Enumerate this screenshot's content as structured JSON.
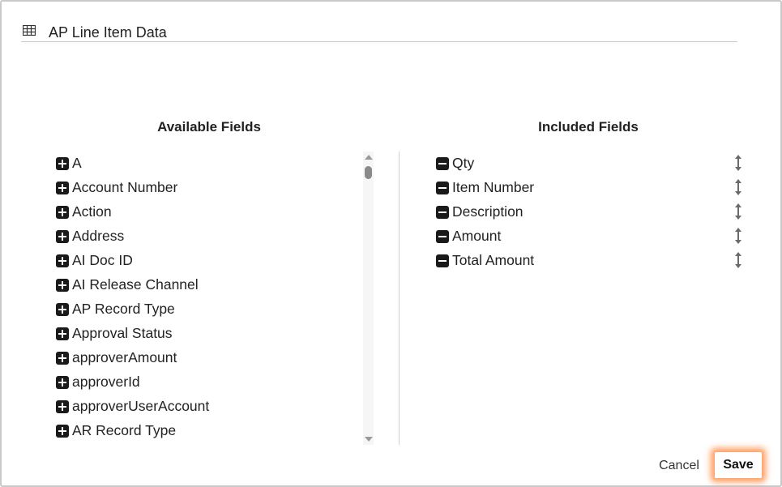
{
  "header": {
    "title": "AP Line Item Data",
    "icon": "table-grid-icon"
  },
  "available": {
    "title": "Available Fields",
    "items": [
      {
        "label": "A"
      },
      {
        "label": "Account Number"
      },
      {
        "label": "Action"
      },
      {
        "label": "Address"
      },
      {
        "label": "AI Doc ID"
      },
      {
        "label": "AI Release Channel"
      },
      {
        "label": "AP Record Type"
      },
      {
        "label": "Approval Status"
      },
      {
        "label": "approverAmount"
      },
      {
        "label": "approverId"
      },
      {
        "label": "approverUserAccount"
      },
      {
        "label": "AR Record Type"
      }
    ]
  },
  "included": {
    "title": "Included Fields",
    "items": [
      {
        "label": "Qty"
      },
      {
        "label": "Item Number"
      },
      {
        "label": "Description"
      },
      {
        "label": "Amount"
      },
      {
        "label": "Total Amount"
      }
    ]
  },
  "footer": {
    "cancel_label": "Cancel",
    "save_label": "Save"
  },
  "colors": {
    "save_highlight": "#ff7a28",
    "icon_fill": "#1a1a1a"
  }
}
